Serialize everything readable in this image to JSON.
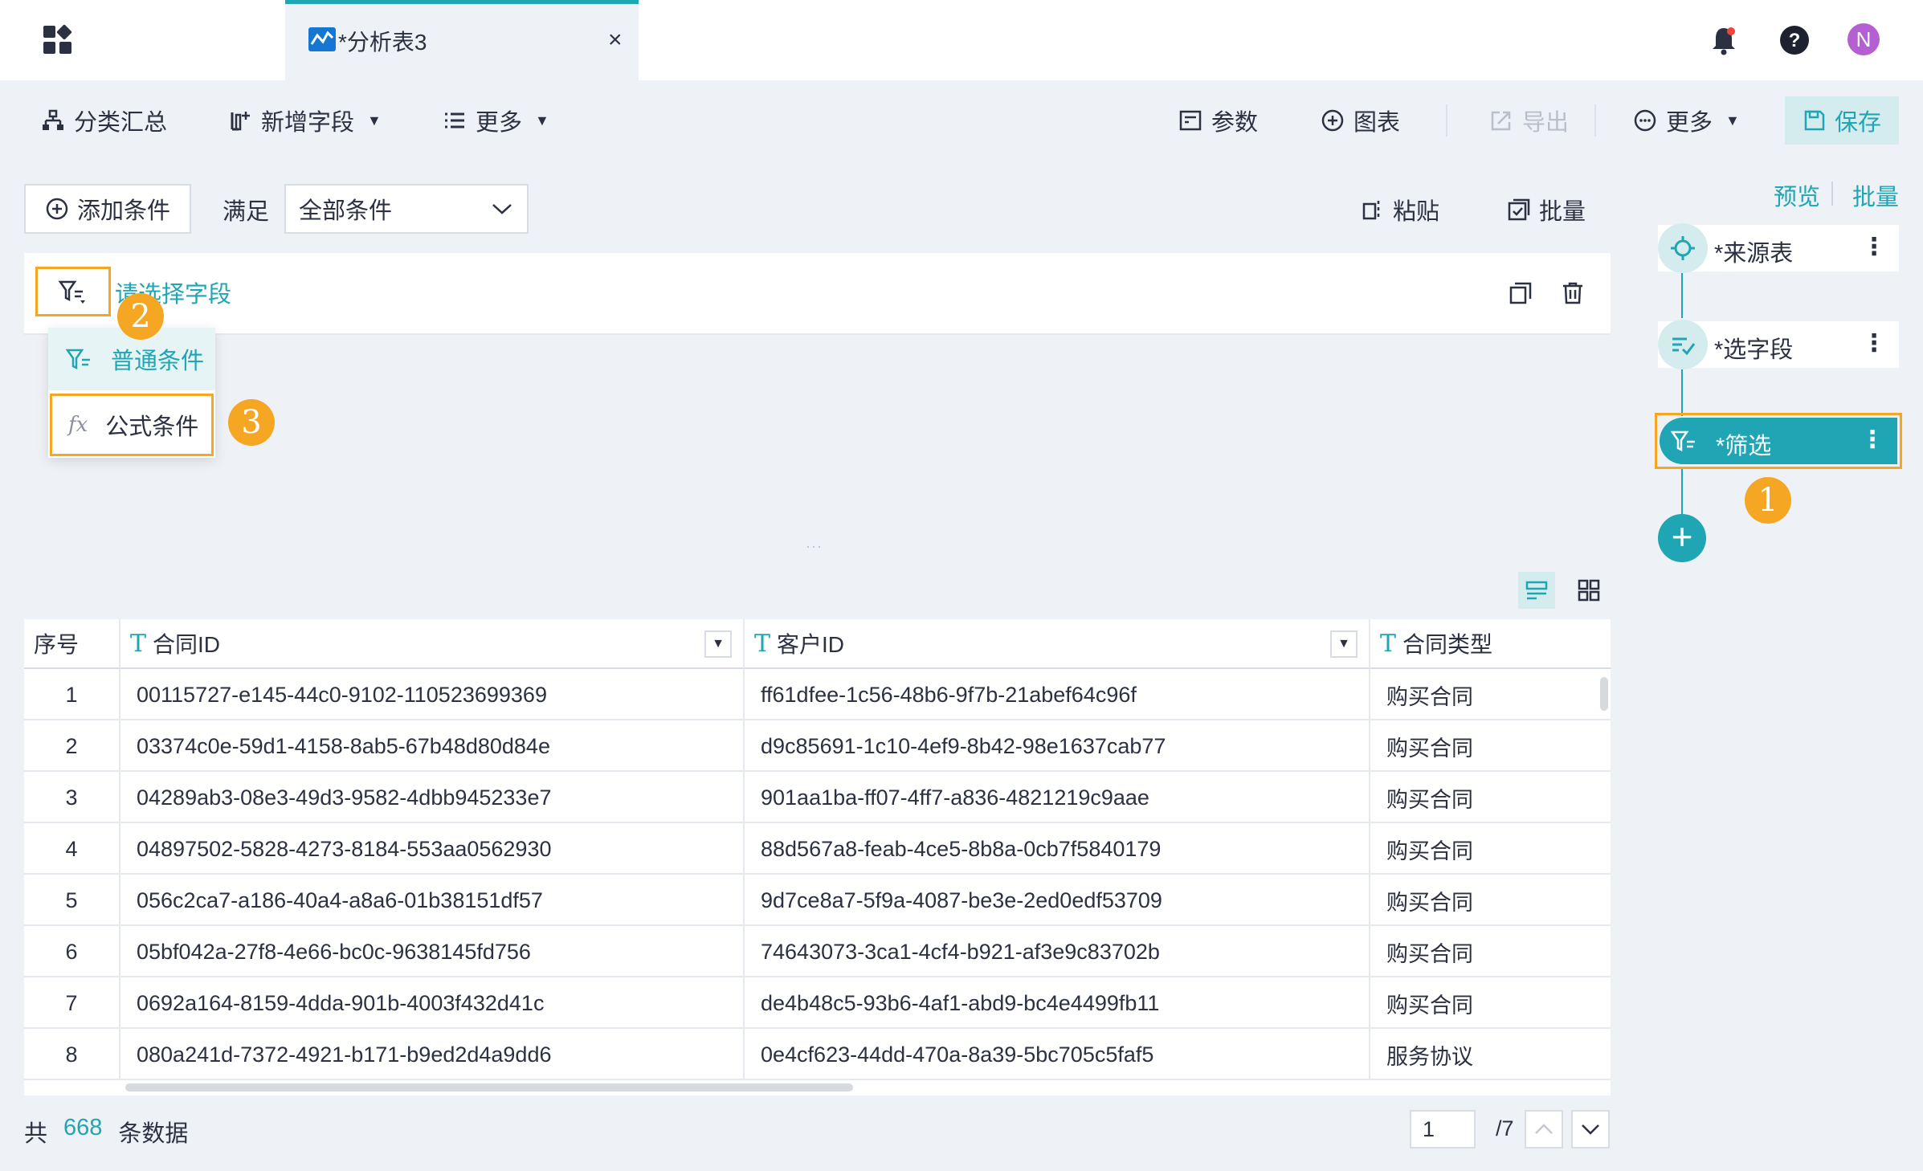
{
  "tab": {
    "title": "*分析表3",
    "close": "×"
  },
  "user": {
    "avatar_letter": "N"
  },
  "toolbar": {
    "group_summary": "分类汇总",
    "add_field": "新增字段",
    "more_left": "更多",
    "params": "参数",
    "chart": "图表",
    "export": "导出",
    "more_right": "更多",
    "save": "保存"
  },
  "condition": {
    "add_condition": "添加条件",
    "satisfy": "满足",
    "select_value": "全部条件",
    "paste": "粘贴",
    "batch": "批量",
    "field_placeholder": "请选择字段"
  },
  "dropdown": {
    "normal": "普通条件",
    "formula": "公式条件"
  },
  "badges": {
    "one": "1",
    "two": "2",
    "three": "3"
  },
  "table": {
    "columns": [
      "序号",
      "合同ID",
      "客户ID",
      "合同类型"
    ],
    "rows": [
      [
        "1",
        "00115727-e145-44c0-9102-110523699369",
        "ff61dfee-1c56-48b6-9f7b-21abef64c96f",
        "购买合同"
      ],
      [
        "2",
        "03374c0e-59d1-4158-8ab5-67b48d80d84e",
        "d9c85691-1c10-4ef9-8b42-98e1637cab77",
        "购买合同"
      ],
      [
        "3",
        "04289ab3-08e3-49d3-9582-4dbb945233e7",
        "901aa1ba-ff07-4ff7-a836-4821219c9aae",
        "购买合同"
      ],
      [
        "4",
        "04897502-5828-4273-8184-553aa0562930",
        "88d567a8-feab-4ce5-8b8a-0cb7f5840179",
        "购买合同"
      ],
      [
        "5",
        "056c2ca7-a186-40a4-a8a6-01b38151df57",
        "9d7ce8a7-5f9a-4087-be3e-2ed0edf53709",
        "购买合同"
      ],
      [
        "6",
        "05bf042a-27f8-4e66-bc0c-9638145fd756",
        "74643073-3ca1-4cf4-b921-af3e9c83702b",
        "购买合同"
      ],
      [
        "7",
        "0692a164-8159-4dda-901b-4003f432d41c",
        "de4b48c5-93b6-4af1-abd9-bc4e4499fb11",
        "购买合同"
      ],
      [
        "8",
        "080a241d-7372-4921-b171-b9ed2d4a9dd6",
        "0e4cf623-44dd-470a-8a39-5bc705c5faf5",
        "服务协议"
      ]
    ]
  },
  "footer": {
    "prefix": "共",
    "count": "668",
    "suffix": "条数据",
    "page": "1",
    "page_total": "/7"
  },
  "flow": {
    "preview": "预览",
    "batch": "批量",
    "nodes": [
      "*来源表",
      "*选字段",
      "*筛选"
    ],
    "add": "+"
  },
  "colors": {
    "accent": "#1fa5b3",
    "highlight": "#f5a623",
    "accent_light": "#d5ecef"
  }
}
